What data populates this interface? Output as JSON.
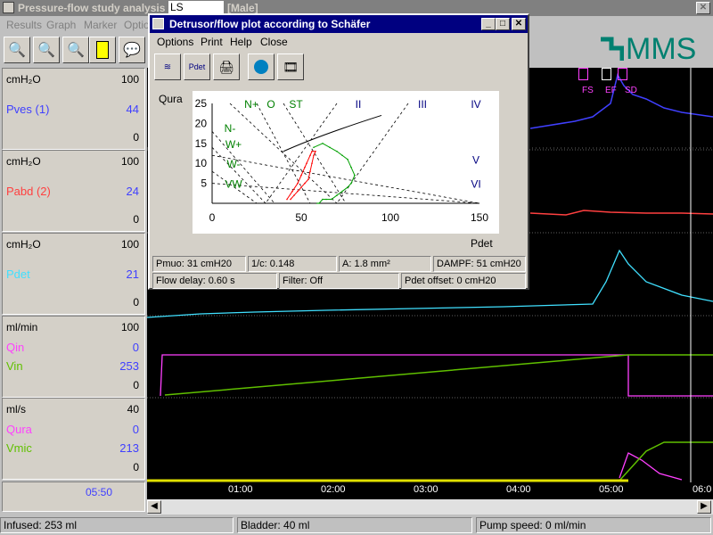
{
  "app": {
    "title": "Pressure-flow study analysis",
    "patient_field": "LS",
    "gender": "[Male]"
  },
  "menu": {
    "results": "Results",
    "graph": "Graph",
    "marker": "Marker",
    "options": "Optio"
  },
  "brand": "MMS",
  "channels": [
    {
      "unit": "cmH₂O",
      "max": "100",
      "name": "Pves (1)",
      "value": "44",
      "zero": "0",
      "color": "#4040ff"
    },
    {
      "unit": "cmH₂O",
      "max": "100",
      "name": "Pabd (2)",
      "value": "24",
      "zero": "0",
      "color": "#ff4040"
    },
    {
      "unit": "cmH₂O",
      "max": "100",
      "name": "Pdet",
      "value": "21",
      "zero": "0",
      "color": "#40e0ff"
    },
    {
      "unit": "ml/min",
      "max": "100",
      "name1": "Qin",
      "value1": "0",
      "name2": "Vin",
      "value2": "253",
      "zero": "0",
      "color1": "#ff40ff",
      "color2": "#60c000"
    },
    {
      "unit": "ml/s",
      "max": "40",
      "name1": "Qura",
      "value1": "0",
      "name2": "Vmic",
      "value2": "213",
      "zero": "0",
      "color1": "#ff40ff",
      "color2": "#60c000"
    }
  ],
  "time_readout": "05:50",
  "time_ticks": [
    "01:00",
    "02:00",
    "03:00",
    "04:00",
    "05:00",
    "06:0"
  ],
  "markers": [
    "FS",
    "EF",
    "SD"
  ],
  "status": {
    "infused": "Infused: 253 ml",
    "bladder": "Bladder: 40 ml",
    "pump": "Pump speed: 0 ml/min"
  },
  "dialog": {
    "title": "Detrusor/flow plot according to Schäfer",
    "menu": [
      "Options",
      "Print",
      "Help",
      "Close"
    ],
    "ylabel": "Qura",
    "xlabel": "Pdet",
    "yticks": [
      "25",
      "20",
      "15",
      "10",
      "5"
    ],
    "xticks": [
      "0",
      "50",
      "100",
      "150"
    ],
    "zone_labels": [
      "N-",
      "N+",
      "O",
      "ST",
      "II",
      "III",
      "IV",
      "W+",
      "W-",
      "VW",
      "V",
      "VI"
    ],
    "fields": {
      "pmuo": "Pmuo: 31 cmH20",
      "one_c": "1/c: 0.148",
      "a": "A: 1.8 mm²",
      "dampf": "DAMPF: 51 cmH20",
      "delay": "Flow delay: 0.60 s",
      "filter": "Filter: Off",
      "offset": "Pdet offset: 0 cmH20"
    }
  },
  "chart_data": {
    "type": "scatter",
    "title": "",
    "xlabel": "Pdet",
    "ylabel": "Qura",
    "xlim": [
      0,
      150
    ],
    "ylim": [
      0,
      25
    ],
    "xticks": [
      0,
      50,
      100,
      150
    ],
    "yticks": [
      5,
      10,
      15,
      20,
      25
    ],
    "series": [
      {
        "name": "",
        "color": "#ff0000",
        "x": [
          42,
          45,
          48,
          50,
          52,
          53,
          55,
          56,
          58,
          57,
          56,
          55,
          54,
          52,
          50,
          48,
          46,
          44
        ],
        "y": [
          1,
          3,
          5,
          7,
          9,
          10,
          12,
          13,
          13,
          12,
          10,
          8,
          6,
          5,
          4,
          3,
          2,
          1
        ]
      },
      {
        "name": "",
        "color": "#00a000",
        "x": [
          57,
          62,
          66,
          70,
          73,
          76,
          78,
          80,
          78,
          76,
          73,
          70,
          67,
          64,
          62,
          60,
          59
        ],
        "y": [
          14,
          15,
          14,
          13,
          12,
          11,
          9,
          7,
          5,
          4,
          3,
          2,
          1,
          1,
          1,
          0,
          0
        ]
      }
    ],
    "grid": false
  }
}
